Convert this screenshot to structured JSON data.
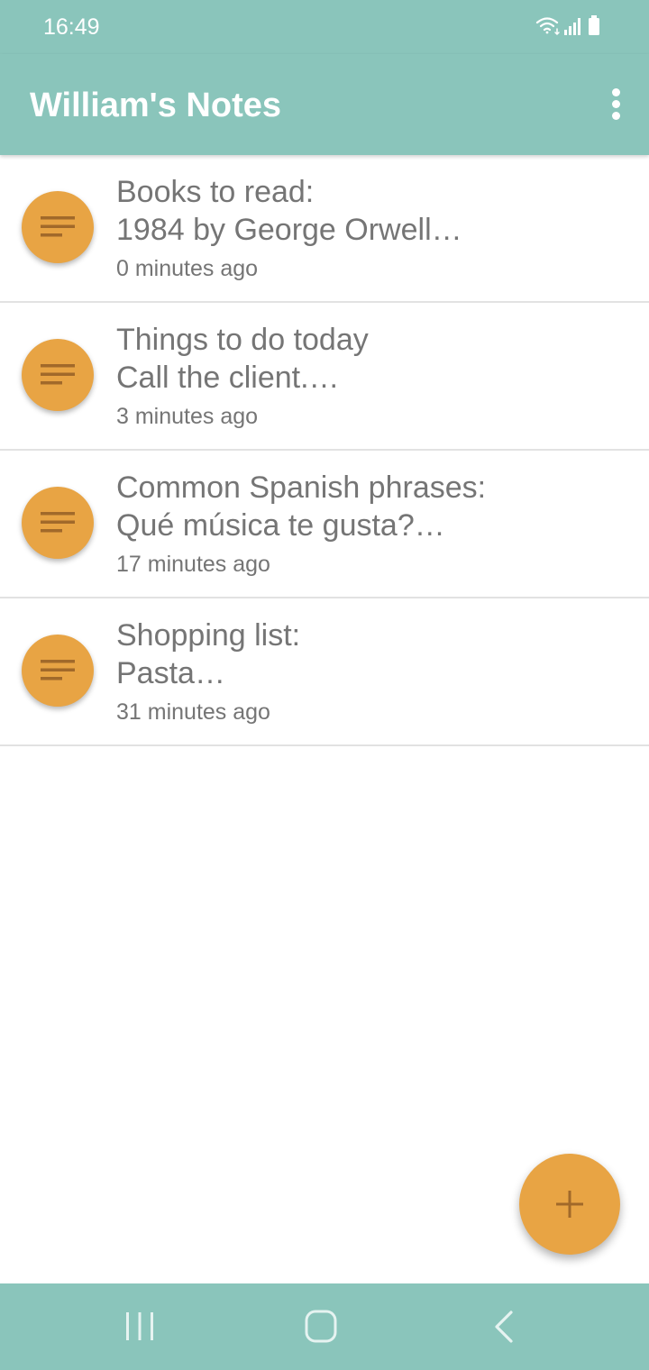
{
  "status_bar": {
    "time": "16:49",
    "icons": [
      "wifi-icon",
      "signal-icon",
      "battery-icon"
    ]
  },
  "app_bar": {
    "title": "William's Notes",
    "menu_icon": "more-vertical-icon"
  },
  "notes": [
    {
      "line1": "Books to read:",
      "line2": "1984 by George Orwell…",
      "time": "0 minutes ago"
    },
    {
      "line1": "Things to do today",
      "line2": "Call the client.…",
      "time": "3 minutes ago"
    },
    {
      "line1": "Common Spanish phrases:",
      "line2": "Qué música te gusta?…",
      "time": "17 minutes ago"
    },
    {
      "line1": "Shopping list:",
      "line2": "Pasta…",
      "time": "31 minutes ago"
    }
  ],
  "note_icon": "notes-lines-icon",
  "fab": {
    "icon": "plus-icon"
  },
  "nav_bar": {
    "buttons": [
      "recent-apps-icon",
      "home-icon",
      "back-icon"
    ]
  },
  "colors": {
    "primary": "#8ac5bb",
    "accent": "#e8a444",
    "icon_dark": "#a1692a",
    "text_secondary": "#757575",
    "divider": "#e2e2e2"
  }
}
